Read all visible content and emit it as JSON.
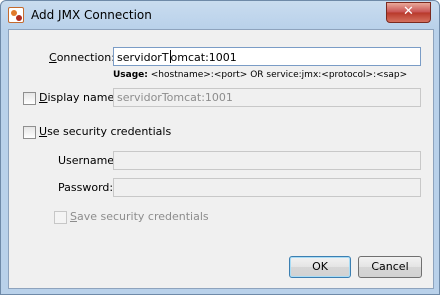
{
  "window": {
    "title": "Add JMX Connection",
    "close_glyph": "✕"
  },
  "connection": {
    "label": "Connection:",
    "mnemonic": "C",
    "label_rest": "onnection:",
    "value_before_caret": "servidorT",
    "value_after_caret": "omcat:1001"
  },
  "usage": {
    "prefix": "Usage:",
    "text": " <hostname>:<port> OR service:jmx:<protocol>:<sap>"
  },
  "display_name": {
    "mnemonic": "D",
    "label_rest": "isplay name:",
    "value": "servidorTomcat:1001",
    "checked": false
  },
  "security": {
    "mnemonic": "U",
    "label_rest": "se security credentials",
    "checked": false,
    "username_label": "Username:",
    "username_value": "",
    "password_label": "Password:",
    "password_value": "",
    "save_mnemonic": "S",
    "save_label_rest": "ave security credentials",
    "save_checked": false
  },
  "buttons": {
    "ok": "OK",
    "cancel": "Cancel"
  },
  "icons": {
    "app": "app-icon",
    "close": "close-icon"
  }
}
